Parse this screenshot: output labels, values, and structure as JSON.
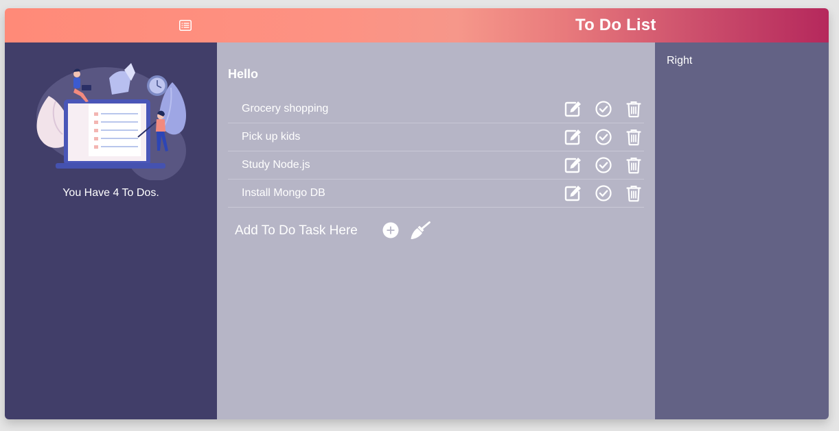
{
  "header": {
    "title": "To Do List",
    "menu_icon": "list-icon",
    "gradient": [
      "#ff8a78",
      "#b5285c"
    ]
  },
  "sidebar": {
    "illustration": "todo-illustration",
    "count_text": "You Have 4 To Dos.",
    "bg_color": "#413e69"
  },
  "main": {
    "greeting": "Hello",
    "bg_color": "#b6b5c6",
    "todos": [
      {
        "text": "Grocery shopping"
      },
      {
        "text": "Pick up kids"
      },
      {
        "text": "Study Node.js"
      },
      {
        "text": "Install Mongo DB"
      }
    ],
    "item_actions": [
      "edit-icon",
      "check-circle-icon",
      "trash-icon"
    ],
    "add_input": {
      "placeholder": "Add To Do Task Here",
      "value": ""
    },
    "add_button_icon": "plus-circle-icon",
    "clear_button_icon": "broom-icon"
  },
  "right_panel": {
    "label": "Right",
    "bg_color": "#636285"
  }
}
